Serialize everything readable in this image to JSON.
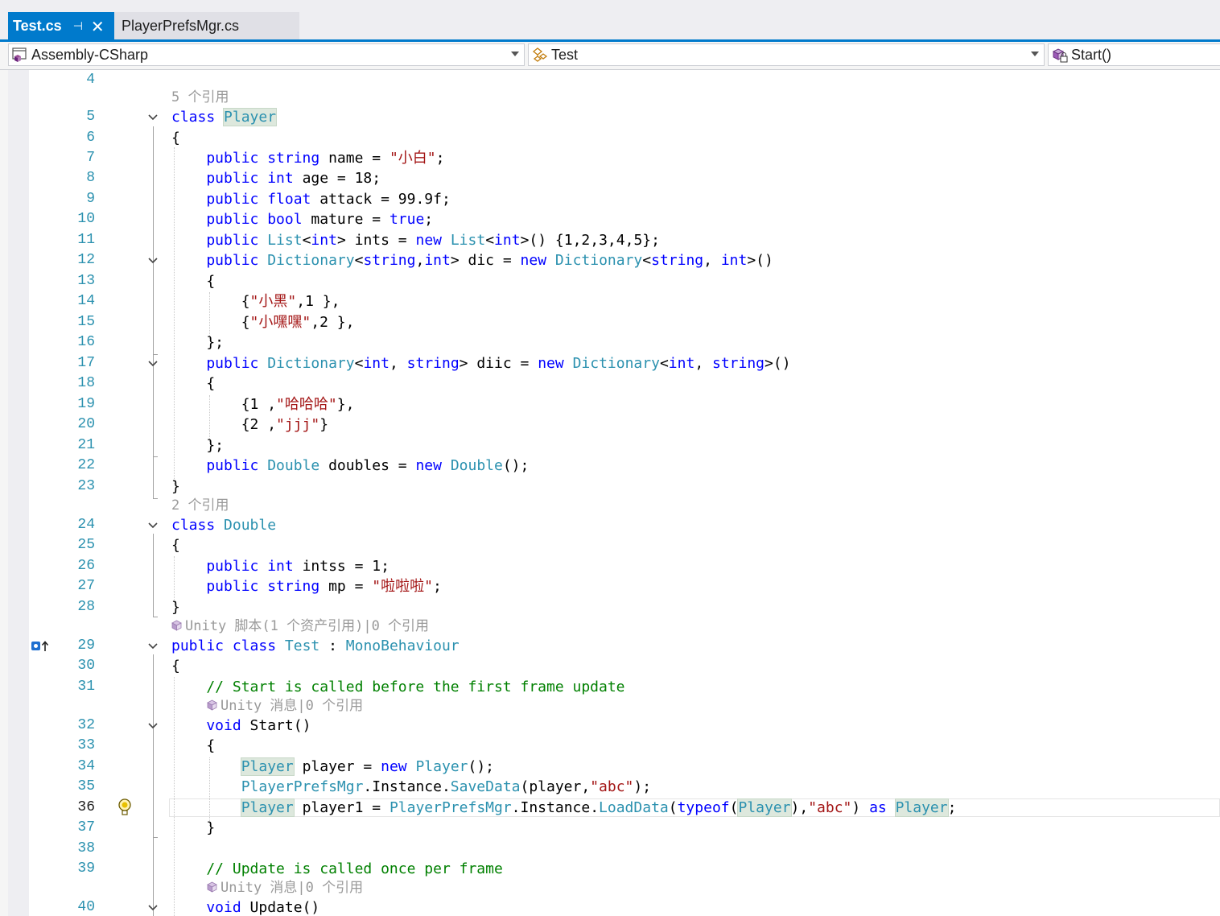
{
  "tabs": {
    "active_title": "Test.cs",
    "pin_glyph": "⊣",
    "close_glyph": "✕",
    "second_title": "PlayerPrefsMgr.cs"
  },
  "navbar": {
    "project": "Assembly-CSharp",
    "type": "Test",
    "member": "Start()"
  },
  "colors": {
    "accent": "#007acc",
    "keyword": "#0000ff",
    "type": "#2b91af",
    "string": "#a31515",
    "comment": "#008000",
    "codelens": "#999999",
    "line_number": "#2b91af"
  },
  "lens": {
    "l5": "5 个引用",
    "l24": "2 个引用",
    "l29": "Unity 脚本(1 个资产引用)|0 个引用",
    "l32": "Unity 消息|0 个引用",
    "l40": "Unity 消息|0 个引用"
  },
  "line_numbers": {
    "n4": "4",
    "n5": "5",
    "n6": "6",
    "n7": "7",
    "n8": "8",
    "n9": "9",
    "n10": "10",
    "n11": "11",
    "n12": "12",
    "n13": "13",
    "n14": "14",
    "n15": "15",
    "n16": "16",
    "n17": "17",
    "n18": "18",
    "n19": "19",
    "n20": "20",
    "n21": "21",
    "n22": "22",
    "n23": "23",
    "n24": "24",
    "n25": "25",
    "n26": "26",
    "n27": "27",
    "n28": "28",
    "n29": "29",
    "n30": "30",
    "n31": "31",
    "n32": "32",
    "n33": "33",
    "n34": "34",
    "n35": "35",
    "n36": "36",
    "n37": "37",
    "n38": "38",
    "n39": "39",
    "n40": "40"
  },
  "code": {
    "l5": [
      [
        "k",
        "class "
      ],
      [
        "hl",
        "Player"
      ]
    ],
    "l6": [
      [
        "p",
        "{"
      ]
    ],
    "l7": [
      [
        "k",
        "    public string "
      ],
      [
        "p",
        "name = "
      ],
      [
        "s",
        "\"小白\""
      ],
      [
        "p",
        ";"
      ]
    ],
    "l8": [
      [
        "k",
        "    public int "
      ],
      [
        "p",
        "age = 18;"
      ]
    ],
    "l9": [
      [
        "k",
        "    public float "
      ],
      [
        "p",
        "attack = 99.9f;"
      ]
    ],
    "l10": [
      [
        "k",
        "    public bool "
      ],
      [
        "p",
        "mature = "
      ],
      [
        "k",
        "true"
      ],
      [
        "p",
        ";"
      ]
    ],
    "l11": [
      [
        "k",
        "    public "
      ],
      [
        "t",
        "List"
      ],
      [
        "p",
        "<"
      ],
      [
        "k",
        "int"
      ],
      [
        "p",
        "> ints = "
      ],
      [
        "k",
        "new "
      ],
      [
        "t",
        "List"
      ],
      [
        "p",
        "<"
      ],
      [
        "k",
        "int"
      ],
      [
        "p",
        ">() {1,2,3,4,5};"
      ]
    ],
    "l12": [
      [
        "k",
        "    public "
      ],
      [
        "t",
        "Dictionary"
      ],
      [
        "p",
        "<"
      ],
      [
        "k",
        "string"
      ],
      [
        "p",
        ","
      ],
      [
        "k",
        "int"
      ],
      [
        "p",
        "> dic = "
      ],
      [
        "k",
        "new "
      ],
      [
        "t",
        "Dictionary"
      ],
      [
        "p",
        "<"
      ],
      [
        "k",
        "string"
      ],
      [
        "p",
        ", "
      ],
      [
        "k",
        "int"
      ],
      [
        "p",
        ">()"
      ]
    ],
    "l13": [
      [
        "p",
        "    {"
      ]
    ],
    "l14": [
      [
        "p",
        "        {"
      ],
      [
        "s",
        "\"小黑\""
      ],
      [
        "p",
        ",1 },"
      ]
    ],
    "l15": [
      [
        "p",
        "        {"
      ],
      [
        "s",
        "\"小嘿嘿\""
      ],
      [
        "p",
        ",2 },"
      ]
    ],
    "l16": [
      [
        "p",
        "    };"
      ]
    ],
    "l17": [
      [
        "k",
        "    public "
      ],
      [
        "t",
        "Dictionary"
      ],
      [
        "p",
        "<"
      ],
      [
        "k",
        "int"
      ],
      [
        "p",
        ", "
      ],
      [
        "k",
        "string"
      ],
      [
        "p",
        "> diic = "
      ],
      [
        "k",
        "new "
      ],
      [
        "t",
        "Dictionary"
      ],
      [
        "p",
        "<"
      ],
      [
        "k",
        "int"
      ],
      [
        "p",
        ", "
      ],
      [
        "k",
        "string"
      ],
      [
        "p",
        ">()"
      ]
    ],
    "l18": [
      [
        "p",
        "    {"
      ]
    ],
    "l19": [
      [
        "p",
        "        {1 ,"
      ],
      [
        "s",
        "\"哈哈哈\""
      ],
      [
        "p",
        "},"
      ]
    ],
    "l20": [
      [
        "p",
        "        {2 ,"
      ],
      [
        "s",
        "\"jjj\""
      ],
      [
        "p",
        "}"
      ]
    ],
    "l21": [
      [
        "p",
        "    };"
      ]
    ],
    "l22": [
      [
        "k",
        "    public "
      ],
      [
        "t",
        "Double "
      ],
      [
        "p",
        "doubles = "
      ],
      [
        "k",
        "new "
      ],
      [
        "t",
        "Double"
      ],
      [
        "p",
        "();"
      ]
    ],
    "l23": [
      [
        "p",
        "}"
      ]
    ],
    "l24": [
      [
        "k",
        "class "
      ],
      [
        "t",
        "Double"
      ]
    ],
    "l25": [
      [
        "p",
        "{"
      ]
    ],
    "l26": [
      [
        "k",
        "    public int "
      ],
      [
        "p",
        "intss = 1;"
      ]
    ],
    "l27": [
      [
        "k",
        "    public string "
      ],
      [
        "p",
        "mp = "
      ],
      [
        "s",
        "\"啦啦啦\""
      ],
      [
        "p",
        ";"
      ]
    ],
    "l28": [
      [
        "p",
        "}"
      ]
    ],
    "l29": [
      [
        "k",
        "public class "
      ],
      [
        "t",
        "Test "
      ],
      [
        "p",
        ": "
      ],
      [
        "t",
        "MonoBehaviour"
      ]
    ],
    "l30": [
      [
        "p",
        "{"
      ]
    ],
    "l31": [
      [
        "c",
        "    // Start is called before the first frame update"
      ]
    ],
    "l32": [
      [
        "k",
        "    void "
      ],
      [
        "p",
        "Start()"
      ]
    ],
    "l33": [
      [
        "p",
        "    {"
      ]
    ],
    "l34": [
      [
        "p",
        "        "
      ],
      [
        "hlt",
        "Player"
      ],
      [
        "p",
        " player = "
      ],
      [
        "k",
        "new "
      ],
      [
        "t",
        "Player"
      ],
      [
        "p",
        "();"
      ]
    ],
    "l35": [
      [
        "t",
        "        PlayerPrefsMgr"
      ],
      [
        "p",
        ".Instance."
      ],
      [
        "t",
        "SaveData"
      ],
      [
        "p",
        "(player,"
      ],
      [
        "s",
        "\"abc\""
      ],
      [
        "p",
        ");"
      ]
    ],
    "l36": [
      [
        "p",
        "        "
      ],
      [
        "hlt",
        "Player"
      ],
      [
        "p",
        " player1 = "
      ],
      [
        "t",
        "PlayerPrefsMgr"
      ],
      [
        "p",
        ".Instance."
      ],
      [
        "t",
        "LoadData"
      ],
      [
        "p",
        "("
      ],
      [
        "k",
        "typeof"
      ],
      [
        "p",
        "("
      ],
      [
        "hlt",
        "Player"
      ],
      [
        "p",
        "),"
      ],
      [
        "s",
        "\"abc\""
      ],
      [
        "p",
        ") "
      ],
      [
        "k",
        "as "
      ],
      [
        "hlt",
        "Player"
      ],
      [
        "p",
        ";"
      ]
    ],
    "l37": [
      [
        "p",
        "    }"
      ]
    ],
    "l38": [
      [
        "p",
        ""
      ]
    ],
    "l39": [
      [
        "c",
        "    // Update is called once per frame"
      ]
    ],
    "l40": [
      [
        "k",
        "    void "
      ],
      [
        "p",
        "Update()"
      ]
    ]
  }
}
